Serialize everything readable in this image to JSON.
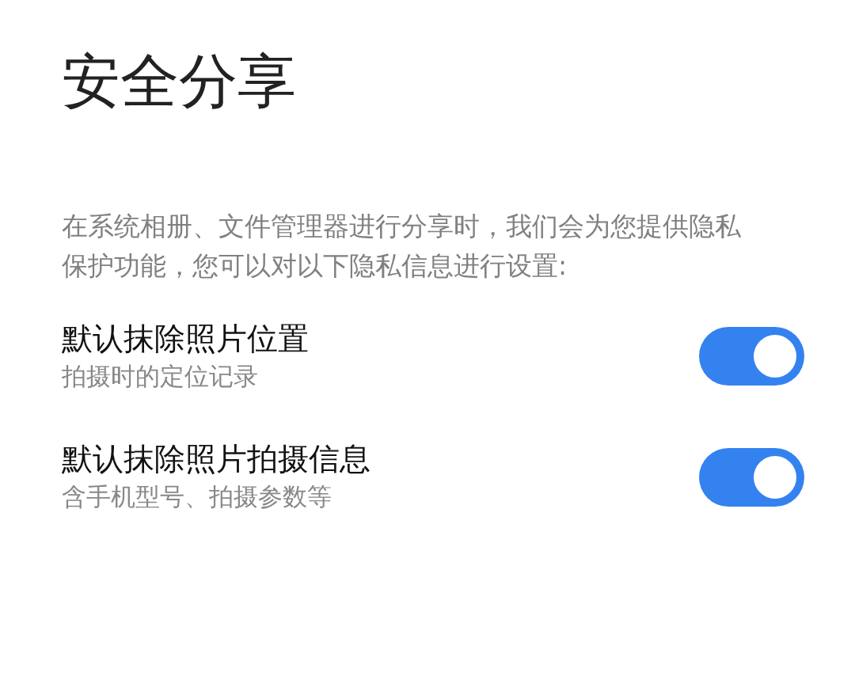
{
  "title": "安全分享",
  "description": "在系统相册、文件管理器进行分享时，我们会为您提供隐私保护功能，您可以对以下隐私信息进行设置:",
  "settings": [
    {
      "label": "默认抹除照片位置",
      "sublabel": "拍摄时的定位记录",
      "on": true
    },
    {
      "label": "默认抹除照片拍摄信息",
      "sublabel": "含手机型号、拍摄参数等",
      "on": true
    }
  ]
}
